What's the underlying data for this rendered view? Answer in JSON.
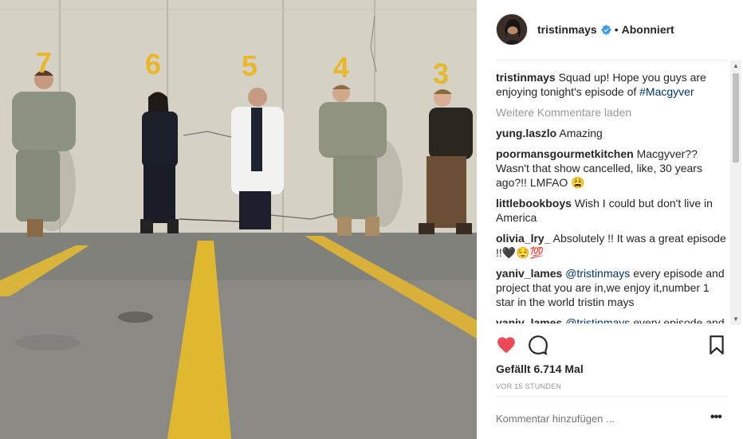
{
  "post": {
    "username": "tristinmays",
    "separator": "•",
    "follow_status": "Abonniert",
    "caption_user": "tristinmays",
    "caption_text": "Squad up! Hope you guys are enjoying tonight's episode of",
    "caption_tag": "#Macgyver",
    "load_more": "Weitere Kommentare laden",
    "likes": "Gefällt 6.714 Mal",
    "time": "VOR 15 STUNDEN",
    "add_comment_placeholder": "Kommentar hinzufügen ...",
    "options": "•••"
  },
  "comments": [
    {
      "user": "yung.laszlo",
      "text": "Amazing",
      "mention": ""
    },
    {
      "user": "poormansgourmetkitchen",
      "text": "Macgyver?? Wasn't that show cancelled, like, 30 years ago?!! LMFAO 😩",
      "mention": ""
    },
    {
      "user": "littlebookboys",
      "text": "Wish I could but don't live in America",
      "mention": ""
    },
    {
      "user": "olivia_lry_",
      "text": "Absolutely !! It was a great episode !!🖤😌💯",
      "mention": ""
    },
    {
      "user": "yaniv_lames",
      "mention": "@tristinmays",
      "text": "every episode and project that you are in,we enjoy it,number 1 star in the world tristin mays"
    },
    {
      "user": "yaniv_lames",
      "mention": "@tristinmays",
      "text": "every episode and project that you are in,we enjoy it"
    }
  ],
  "photo": {
    "stall_numbers": [
      "7",
      "6",
      "5",
      "4",
      "3"
    ]
  },
  "colors": {
    "heart": "#ed4956",
    "link": "#003569",
    "verified": "#3897f0",
    "paint_yellow": "#e8b82a"
  },
  "icons": [
    "heart-icon",
    "comment-icon",
    "bookmark-icon",
    "verified-icon"
  ]
}
